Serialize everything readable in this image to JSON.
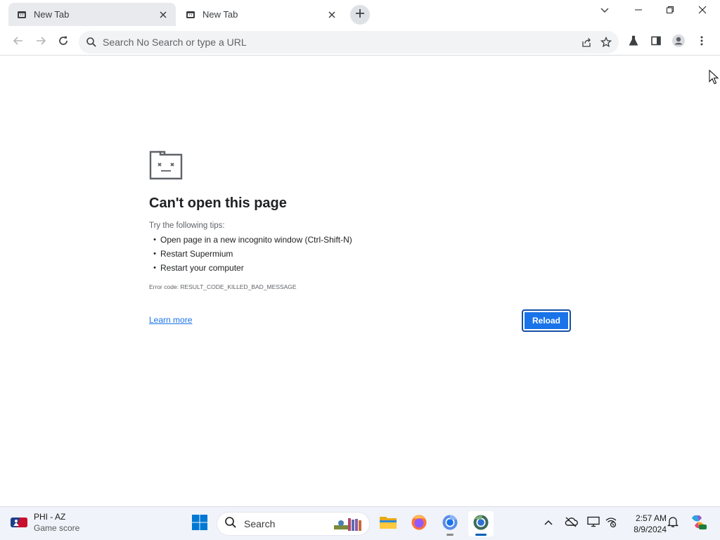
{
  "tabs": [
    {
      "title": "New Tab",
      "active": false
    },
    {
      "title": "New Tab",
      "active": true
    }
  ],
  "toolbar": {
    "omnibox_placeholder": "Search No Search or type a URL",
    "omnibox_value": ""
  },
  "error_page": {
    "title": "Can't open this page",
    "tips_heading": "Try the following tips:",
    "tips": [
      "Open page in a new incognito window (Ctrl-Shift-N)",
      "Restart Supermium",
      "Restart your computer"
    ],
    "error_code": "Error code: RESULT_CODE_KILLED_BAD_MESSAGE",
    "learn_more": "Learn more",
    "reload_label": "Reload"
  },
  "taskbar": {
    "widget": {
      "line1": "PHI - AZ",
      "line2": "Game score"
    },
    "search_label": "Search",
    "clock": {
      "time": "2:57 AM",
      "date": "8/9/2024"
    }
  },
  "colors": {
    "accent": "#1a73e8",
    "tab_inactive_bg": "#e8eaed",
    "omnibox_bg": "#f1f3f4",
    "taskbar_bg": "#f0f3f9"
  },
  "icons": [
    "tab-favicon-icon",
    "close-icon",
    "plus-icon",
    "chevron-down-icon",
    "minimize-icon",
    "restore-icon",
    "back-arrow-icon",
    "forward-arrow-icon",
    "reload-icon",
    "search-icon",
    "share-icon",
    "star-icon",
    "labs-flask-icon",
    "side-panel-icon",
    "profile-icon",
    "more-vert-icon",
    "sad-folder-icon",
    "windows-start-icon",
    "file-explorer-icon",
    "firefox-icon",
    "chromium-icon",
    "supermium-icon",
    "chevron-up-icon",
    "onedrive-icon",
    "display-icon",
    "network-icon",
    "bell-icon",
    "copilot-icon"
  ]
}
